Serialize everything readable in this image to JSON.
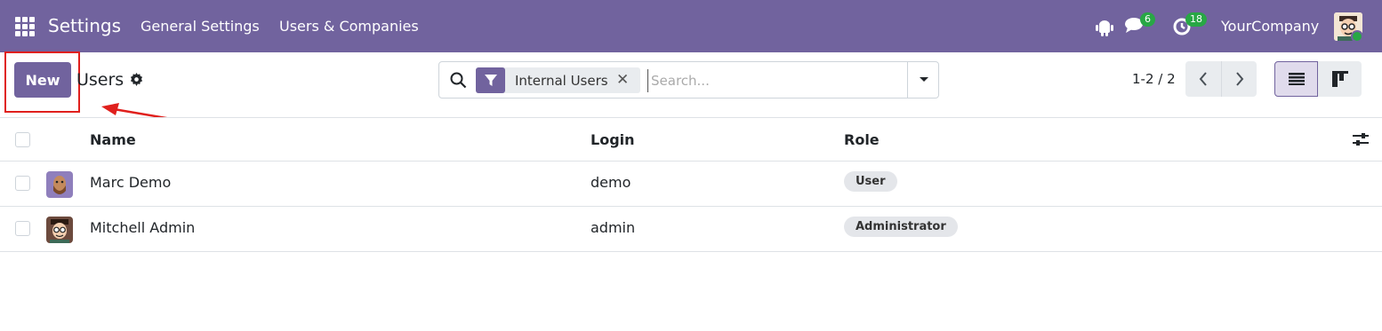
{
  "navbar": {
    "app_title": "Settings",
    "menu": [
      "General Settings",
      "Users & Companies"
    ],
    "chat_count": "6",
    "activity_count": "18",
    "company": "YourCompany",
    "bg_color": "#71639e"
  },
  "control": {
    "new_label": "New",
    "title": "Users",
    "search": {
      "facet_label": "Internal Users",
      "placeholder": "Search..."
    },
    "pager": "1-2 / 2"
  },
  "table": {
    "columns": {
      "name": "Name",
      "login": "Login",
      "role": "Role"
    },
    "rows": [
      {
        "name": "Marc Demo",
        "login": "demo",
        "role": "User"
      },
      {
        "name": "Mitchell Admin",
        "login": "admin",
        "role": "Administrator"
      }
    ]
  },
  "icons": [
    "apps-icon",
    "bug-icon",
    "chat-icon",
    "activity-icon",
    "gear-icon",
    "search-icon",
    "filter-icon",
    "close-icon",
    "caret-down-icon",
    "chevron-left-icon",
    "chevron-right-icon",
    "list-view-icon",
    "kanban-view-icon",
    "column-settings-icon"
  ],
  "annotation_color": "#e0201d"
}
